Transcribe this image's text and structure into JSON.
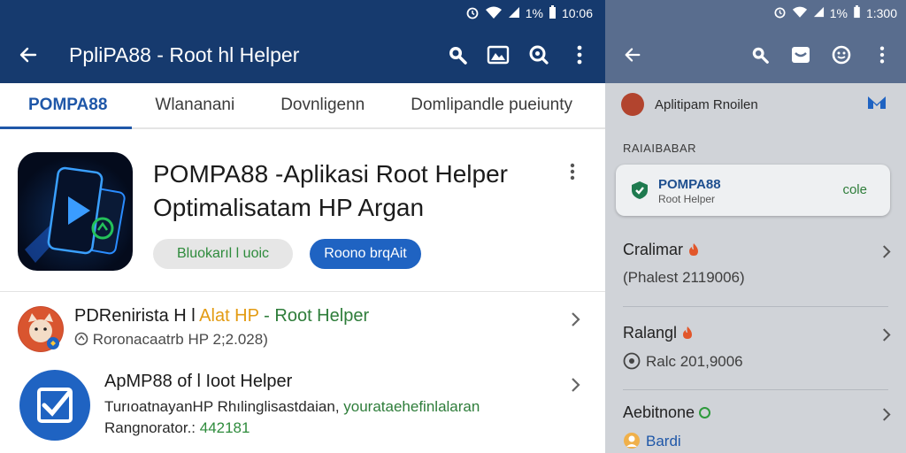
{
  "left": {
    "status": {
      "icons": [
        "alarm-icon",
        "wifi-icon",
        "signal-icon",
        "battery-icon"
      ],
      "battery": "1%",
      "time": "10:06"
    },
    "appbar": {
      "title": "PpliPA88 - Root hl Helper"
    },
    "tabs": [
      {
        "label": "POMPA88",
        "active": true
      },
      {
        "label": "Wlananani",
        "active": false
      },
      {
        "label": "Dovnligenn",
        "active": false
      },
      {
        "label": "Domlipandle pueiunty",
        "active": false
      }
    ],
    "app": {
      "title_line1": "POMPA88 -Aplikasi Root Helper",
      "title_line2": "Optimalisatam HP Argan",
      "pill_gray": "Bluokarıl l uoic",
      "pill_blue": "Roono brqAit"
    },
    "list": [
      {
        "title_a": "PDRenirista H l ",
        "title_b": "Alat HP",
        "title_c": " - Root Helper",
        "subtitle": "Roronacaatrb HP 2;2.028)"
      },
      {
        "title": "ApMP88 of l Ioot Helper",
        "subtitle_a": "TurıoatnayanHP Rhılinglisastdaian, ",
        "subtitle_b": "yourataehefinlalaran",
        "meta_a": "Rangnorator.:",
        "meta_b": " 442181"
      }
    ]
  },
  "right": {
    "status": {
      "battery": "1%",
      "time": "1:300"
    },
    "header": {
      "label": "Aplitipam Rnoilen"
    },
    "section": "RAIAIBABAR",
    "card": {
      "title": "POMPA88",
      "subtitle": "Root Helper",
      "action": "cole"
    },
    "items": [
      {
        "title": "Cralimar",
        "subtitle": "(Phalest 2119006)"
      },
      {
        "title": "Ralangl",
        "subtitle": "Ralc 201,9006"
      },
      {
        "title": "Aebitnone",
        "subtitle": "Bardi"
      }
    ]
  },
  "colors": {
    "appbar": "#163a6e",
    "accent": "#1f57a8",
    "pill_blue": "#1f63c2",
    "green_text": "#2e8b3c",
    "orange_text": "#e39b12",
    "overlay_appbar": "#596d8e"
  }
}
